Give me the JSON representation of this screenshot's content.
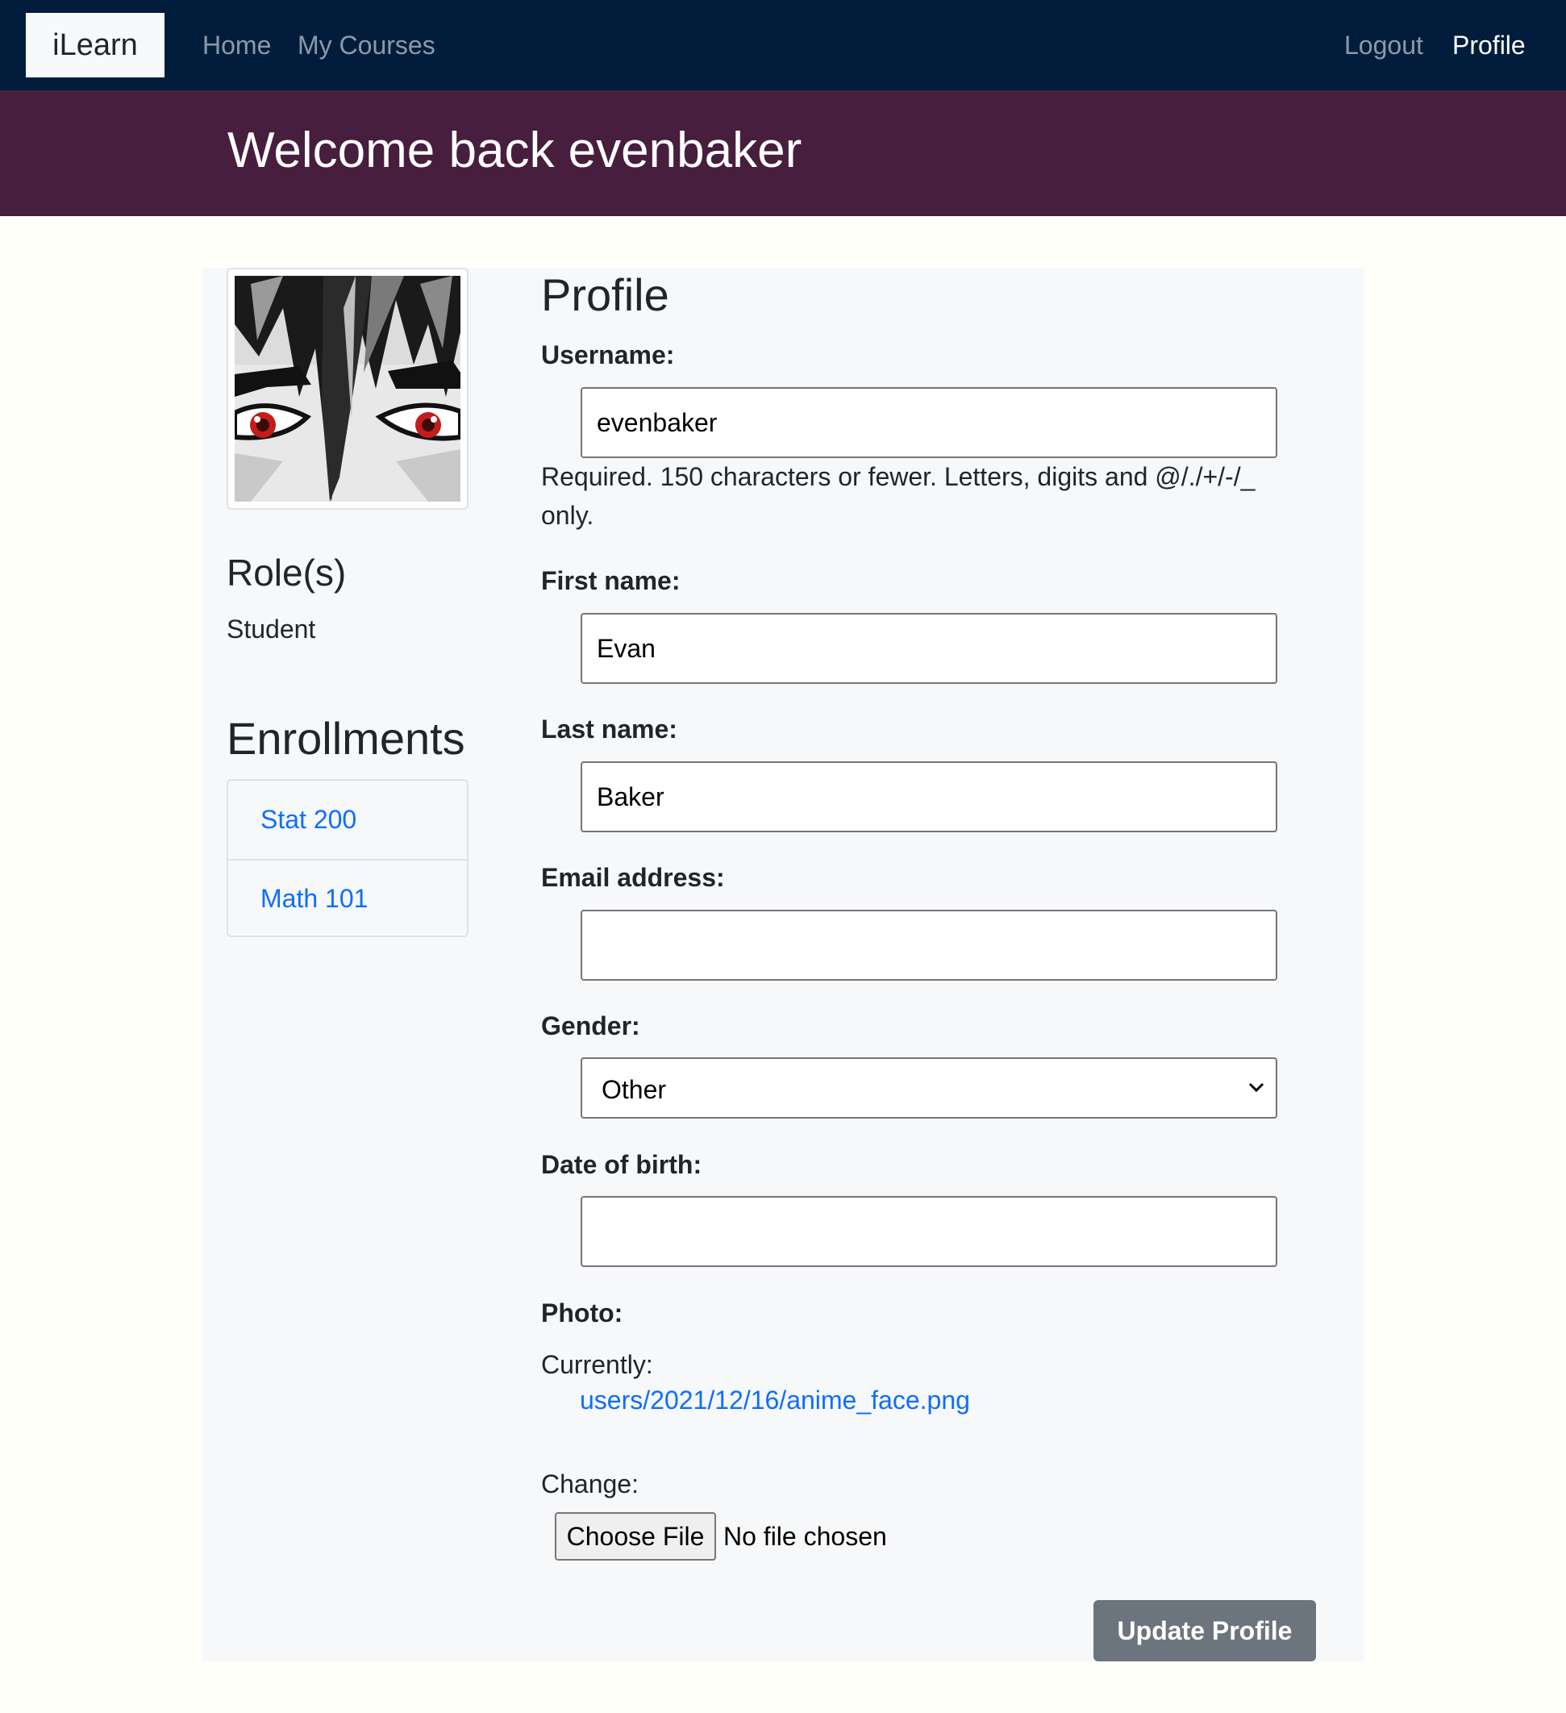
{
  "navbar": {
    "brand": "iLearn",
    "left_links": [
      "Home",
      "My Courses"
    ],
    "logout": "Logout",
    "profile": "Profile"
  },
  "banner": {
    "title": "Welcome back evenbaker"
  },
  "sidebar": {
    "avatar_icon": "anime-face-avatar",
    "roles_heading": "Role(s)",
    "roles": [
      "Student"
    ],
    "enrollments_heading": "Enrollments",
    "enrollments": [
      "Stat 200",
      "Math 101"
    ]
  },
  "form": {
    "title": "Profile",
    "username": {
      "label": "Username:",
      "value": "evenbaker",
      "help": "Required. 150 characters or fewer. Letters, digits and @/./+/-/_ only."
    },
    "first_name": {
      "label": "First name:",
      "value": "Evan"
    },
    "last_name": {
      "label": "Last name:",
      "value": "Baker"
    },
    "email": {
      "label": "Email address:",
      "value": ""
    },
    "gender": {
      "label": "Gender:",
      "selected": "Other"
    },
    "dob": {
      "label": "Date of birth:",
      "value": ""
    },
    "photo": {
      "label": "Photo:",
      "currently_label": "Currently:",
      "current_file": "users/2021/12/16/anime_face.png",
      "change_label": "Change:",
      "choose_button": "Choose File",
      "no_file": "No file chosen"
    },
    "submit": "Update Profile"
  },
  "colors": {
    "navbar_bg": "#021d3c",
    "banner_bg": "#471e3d",
    "link": "#0d6efd",
    "button_secondary": "#6c757d",
    "page_bg": "#fffef8",
    "card_bg": "#f7f8fa"
  }
}
